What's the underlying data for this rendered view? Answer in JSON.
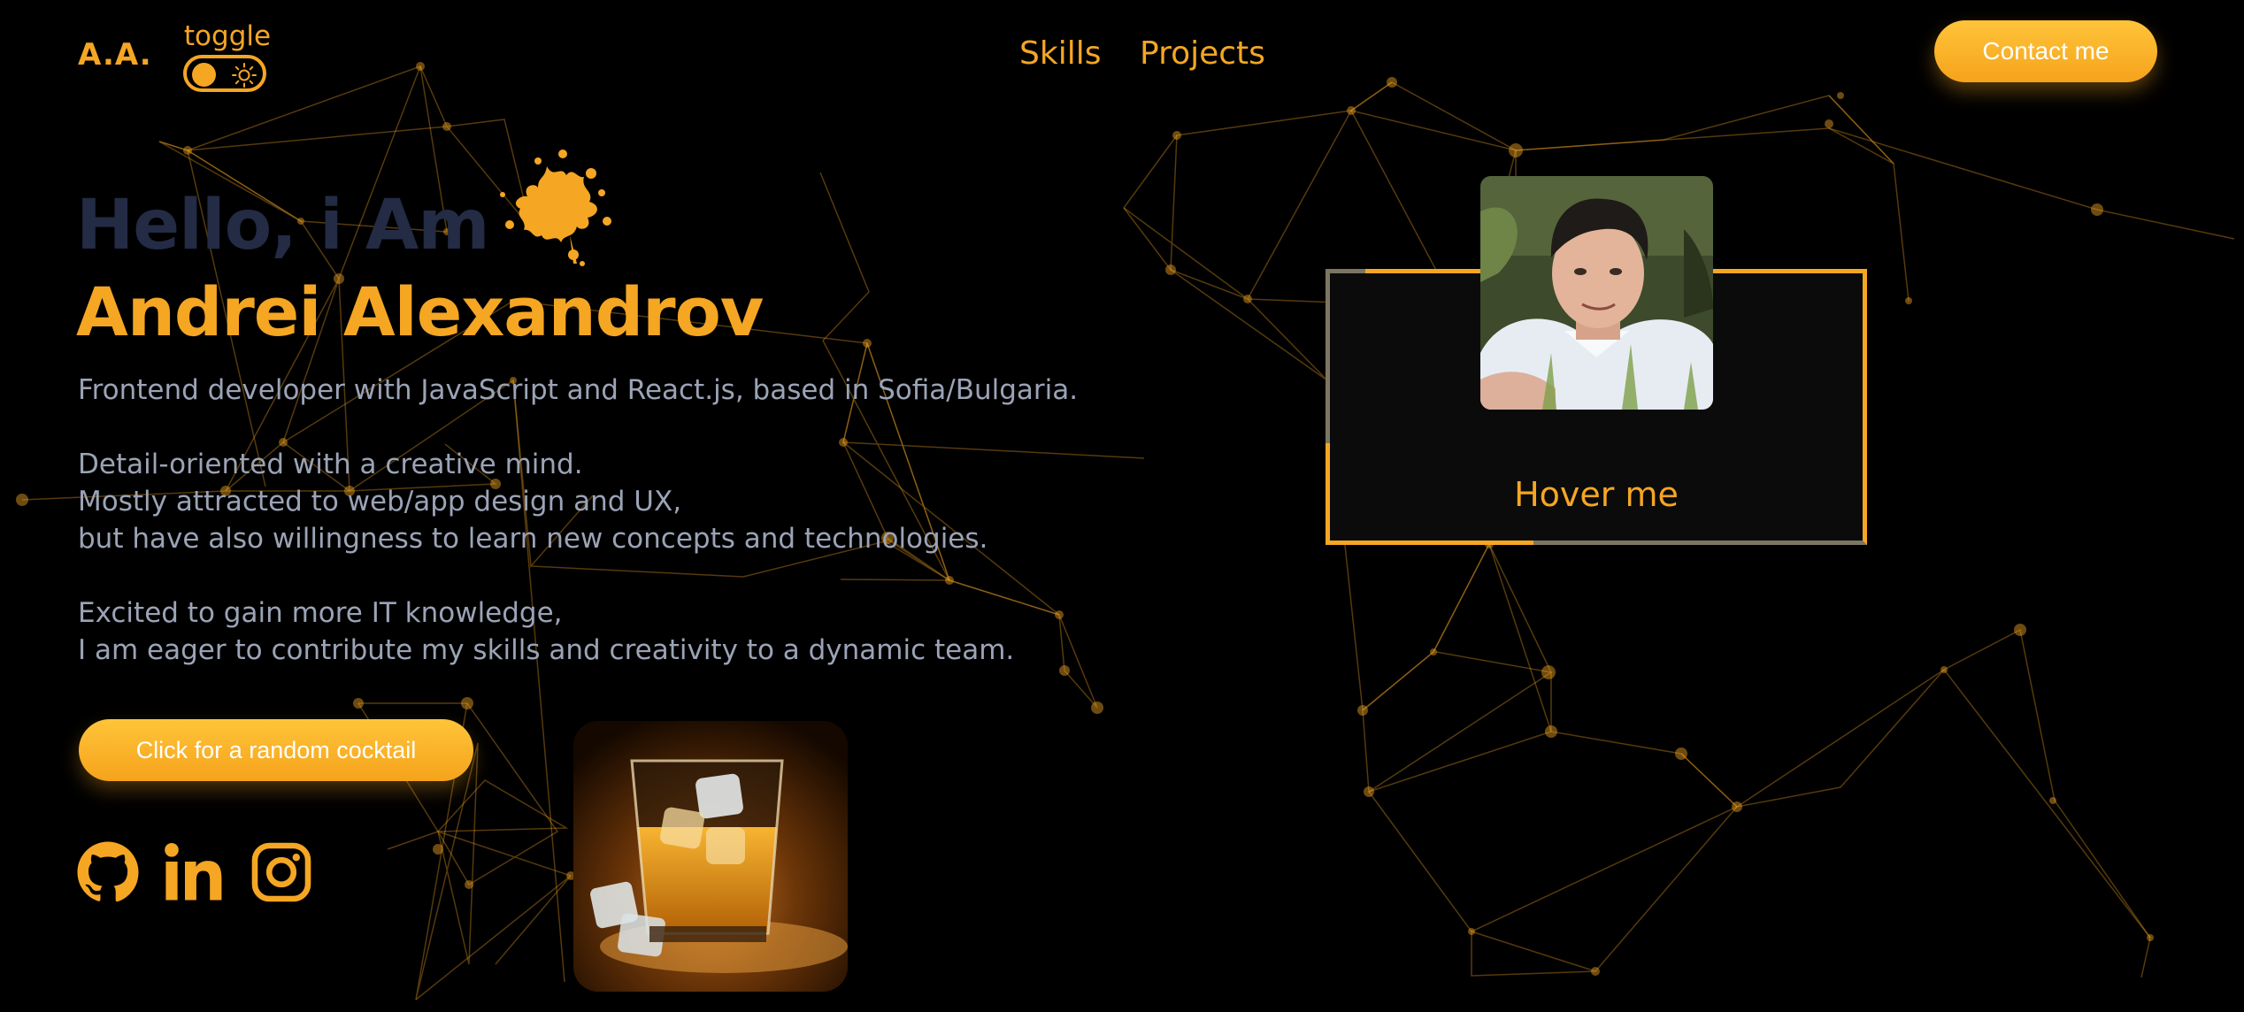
{
  "header": {
    "logo": "A.A.",
    "toggle_label": "toggle",
    "nav": [
      {
        "label": "Skills"
      },
      {
        "label": "Projects"
      }
    ],
    "contact_label": "Contact me"
  },
  "hero": {
    "greeting": "Hello, i Am",
    "name": "Andrei Alexandrov",
    "bio_line_1": "Frontend developer with JavaScript and React.js, based in Sofia/Bulgaria.",
    "bio_para_2": [
      "Detail-oriented with a creative mind.",
      "Mostly attracted to web/app design and UX,",
      "but have also willingness to learn new concepts and technologies."
    ],
    "bio_para_3": [
      "Excited to gain more IT knowledge,",
      "I am eager to contribute my skills and creativity to a dynamic team."
    ],
    "cocktail_button": "Click for a random cocktail"
  },
  "social": [
    {
      "icon": "github-icon"
    },
    {
      "icon": "linkedin-icon"
    },
    {
      "icon": "instagram-icon"
    }
  ],
  "profile_card": {
    "hover_label": "Hover me"
  },
  "colors": {
    "accent": "#f5a623",
    "background": "#000000",
    "text_muted": "#9ba3b6",
    "greeting": "#232b45"
  }
}
